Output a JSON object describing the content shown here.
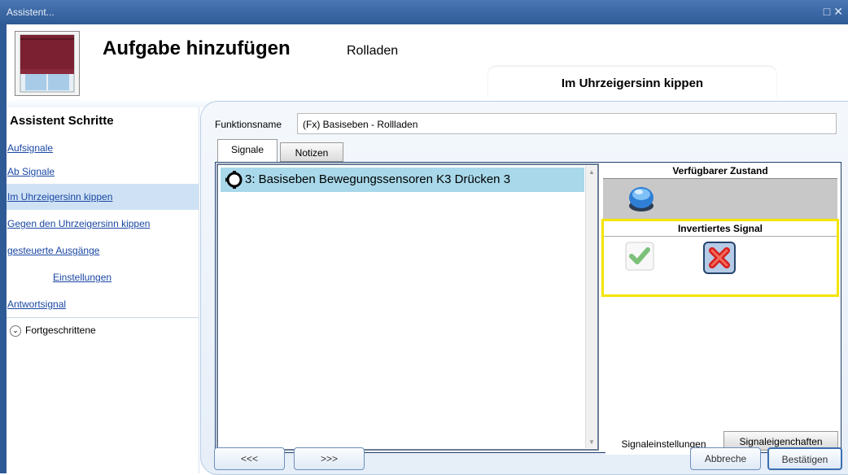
{
  "window": {
    "title": "Assistent...",
    "controls": "□ ✕"
  },
  "header": {
    "title": "Aufgabe hinzufügen",
    "subtitle": "Rolladen",
    "current_step": "Im Uhrzeigersinn kippen"
  },
  "sidebar": {
    "title": "Assistent Schritte",
    "items": [
      {
        "label": "Aufsignale",
        "active": false,
        "indent": false
      },
      {
        "label": "Ab Signale",
        "active": false,
        "indent": false
      },
      {
        "label": "Im Uhrzeigersinn kippen",
        "active": true,
        "indent": false
      },
      {
        "label": "Gegen den Uhrzeigersinn kippen",
        "active": false,
        "indent": false
      },
      {
        "label": "gesteuerte Ausgänge",
        "active": false,
        "indent": false
      },
      {
        "label": "Einstellungen",
        "active": false,
        "indent": true
      },
      {
        "label": "Antwortsignal",
        "active": false,
        "indent": false
      }
    ],
    "advanced_label": "Fortgeschrittene"
  },
  "form": {
    "function_name_label": "Funktionsname",
    "function_name_value": "(Fx) Basiseben - Rollladen"
  },
  "tabs": [
    "Signale",
    "Notizen"
  ],
  "signals": [
    {
      "label": "3: Basiseben Bewegungssensoren K3 Drücken 3",
      "selected": true
    }
  ],
  "state_panel": {
    "available_state_title": "Verfügbarer Zustand",
    "inverted_signal_title": "Invertiertes Signal"
  },
  "subtabs": [
    "Signaleinstellungen",
    "Signaleigenchaften"
  ],
  "buttons": {
    "prev": "<<<",
    "next": ">>>",
    "cancel": "Abbreche",
    "confirm": "Bestätigen"
  },
  "colors": {
    "title_bar": "#3a6ba8",
    "selection": "#a8d8ea",
    "highlight_frame": "#f5e400",
    "link": "#1a47a3"
  }
}
